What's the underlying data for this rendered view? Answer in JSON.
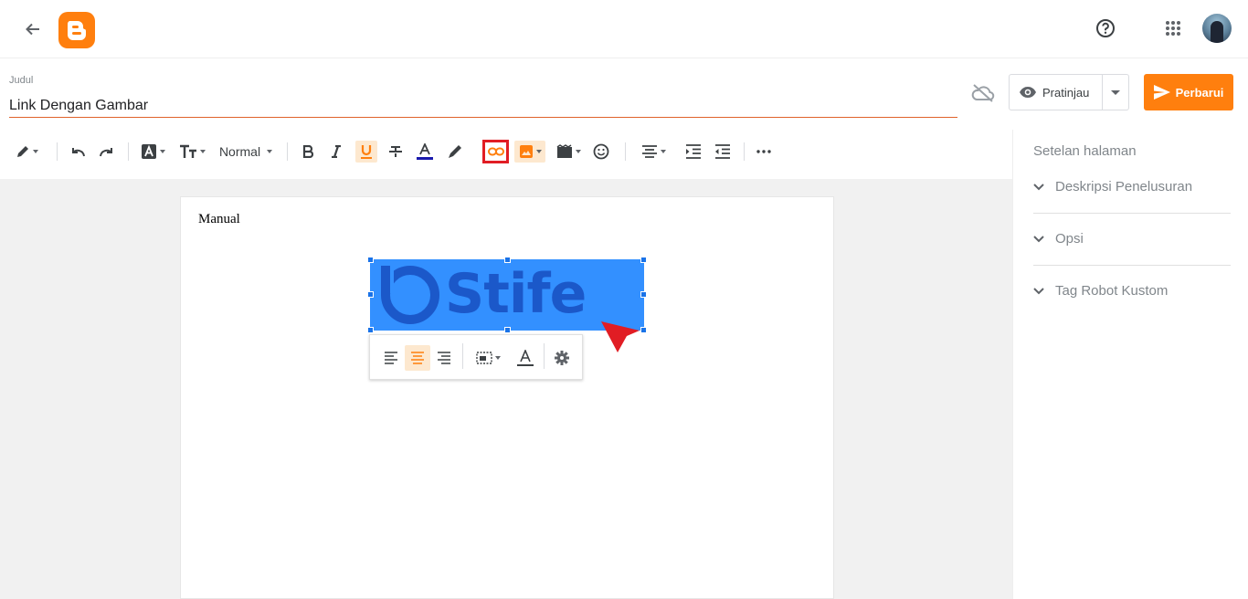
{
  "header": {
    "back_icon": "arrow-left-icon",
    "logo_icon": "blogger-logo",
    "help_icon": "help-icon",
    "apps_icon": "apps-grid-icon",
    "brand_color": "#ff7f0e"
  },
  "post": {
    "title_label": "Judul",
    "title_value": "Link Dengan Gambar"
  },
  "actions": {
    "preview_label": "Pratinjau",
    "publish_label": "Perbarui"
  },
  "toolbar": {
    "format_value": "Normal",
    "items": [
      "pencil-icon",
      "undo-icon",
      "redo-icon",
      "font-icon",
      "font-size-icon",
      "format-select",
      "bold-icon",
      "italic-icon",
      "underline-icon",
      "strikethrough-icon",
      "text-color-icon",
      "highlight-icon",
      "link-icon",
      "image-icon",
      "video-icon",
      "emoji-icon",
      "align-icon",
      "indent-icon",
      "outdent-icon",
      "more-icon"
    ],
    "highlighted": "link-icon"
  },
  "editor": {
    "body_text": "Manual",
    "image_text": "Stife"
  },
  "image_toolbar": {
    "items": [
      "align-left-icon",
      "align-center-icon",
      "align-right-icon",
      "image-size-icon",
      "caption-icon",
      "settings-icon"
    ],
    "active": "align-center-icon"
  },
  "sidebar": {
    "title": "Setelan halaman",
    "sections": [
      {
        "label": "Deskripsi Penelusuran"
      },
      {
        "label": "Opsi"
      },
      {
        "label": "Tag Robot Kustom"
      }
    ]
  }
}
